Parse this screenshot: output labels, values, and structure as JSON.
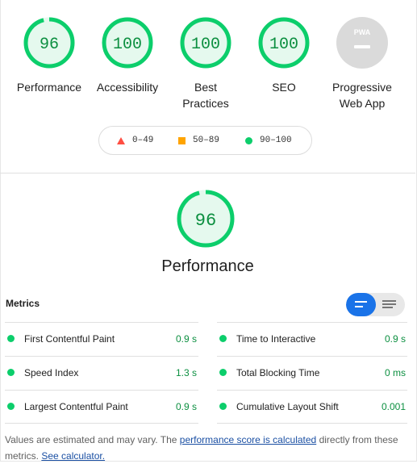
{
  "gauges": [
    {
      "score": "96",
      "label": "Performance"
    },
    {
      "score": "100",
      "label": "Accessibility"
    },
    {
      "score": "100",
      "label": "Best Practices"
    },
    {
      "score": "100",
      "label": "SEO"
    },
    {
      "score": "PWA",
      "label": "Progressive Web App"
    }
  ],
  "legend": {
    "poor": "0–49",
    "average": "50–89",
    "good": "90–100"
  },
  "performance": {
    "score": "96",
    "title": "Performance"
  },
  "metrics": {
    "heading": "Metrics",
    "items": [
      {
        "name": "First Contentful Paint",
        "value": "0.9 s"
      },
      {
        "name": "Time to Interactive",
        "value": "0.9 s"
      },
      {
        "name": "Speed Index",
        "value": "1.3 s"
      },
      {
        "name": "Total Blocking Time",
        "value": "0 ms"
      },
      {
        "name": "Largest Contentful Paint",
        "value": "0.9 s"
      },
      {
        "name": "Cumulative Layout Shift",
        "value": "0.001"
      }
    ]
  },
  "note": {
    "prefix": "Values are estimated and may vary. The",
    "link1": "performance score is calculated",
    "middle": "directly from these metrics.",
    "link2": "See calculator."
  },
  "colors": {
    "pass": "#0cce6b",
    "pass_text": "#0c8f40",
    "fail": "#ff4e42",
    "average": "#ffa400",
    "toggle_active": "#1a73e8"
  }
}
